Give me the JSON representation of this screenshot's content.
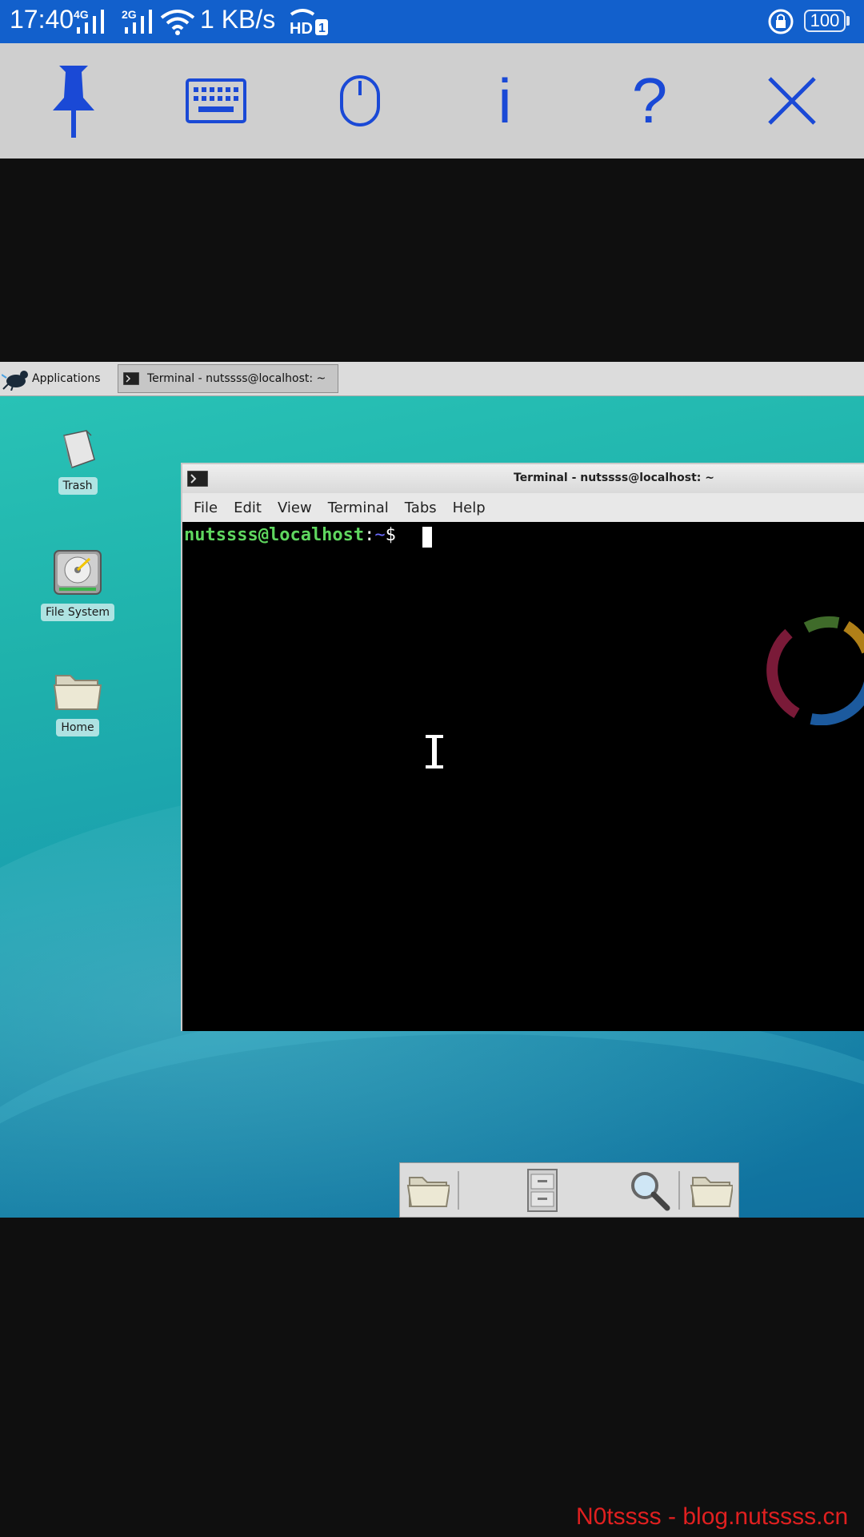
{
  "status_bar": {
    "time": "17:40",
    "signal1_label": "4G",
    "signal2_label": "2G",
    "speed": "1 KB/s",
    "battery": "100",
    "colors": {
      "background": "#1260cc"
    }
  },
  "toolbar": {
    "icons": [
      "pin-icon",
      "keyboard-icon",
      "mouse-icon",
      "info-icon",
      "help-icon",
      "close-icon"
    ],
    "info_glyph": "i",
    "help_glyph": "?",
    "color": "#1a49d6"
  },
  "desktop": {
    "panel": {
      "applications_label": "Applications",
      "task_label": "Terminal - nutssss@localhost: ~"
    },
    "icons": [
      {
        "label": "Trash",
        "icon": "trash-icon"
      },
      {
        "label": "File System",
        "icon": "drive-icon"
      },
      {
        "label": "Home",
        "icon": "folder-icon"
      }
    ],
    "terminal": {
      "title": "Terminal - nutssss@localhost: ~",
      "menu": [
        "File",
        "Edit",
        "View",
        "Terminal",
        "Tabs",
        "Help"
      ],
      "prompt_user": "nutssss@localhost",
      "prompt_sep": ":",
      "prompt_path": "~",
      "prompt_symbol": "$"
    },
    "dock_icons": [
      "folder-icon",
      "file-cabinet-icon",
      "magnifier-icon",
      "folder-icon"
    ]
  },
  "watermark": "N0tssss - blog.nutssss.cn"
}
